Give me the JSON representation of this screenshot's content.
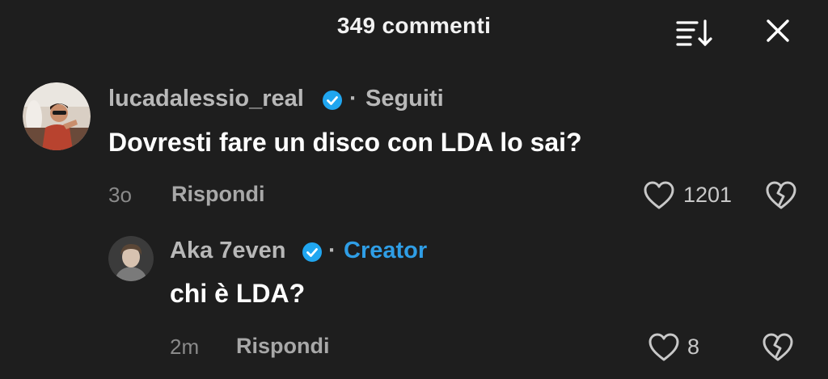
{
  "header": {
    "title": "349 commenti",
    "sort_icon": "sort-descending-icon",
    "close_icon": "close-icon"
  },
  "comments": [
    {
      "username": "lucadalessio_real",
      "verified": true,
      "separator": "·",
      "tag": "Seguiti",
      "text": "Dovresti fare un disco con LDA lo sai?",
      "time": "3o",
      "reply_label": "Rispondi",
      "likes": "1201"
    }
  ],
  "reply": {
    "username": "Aka 7even",
    "verified": true,
    "separator": "·",
    "tag": "Creator",
    "text": "chi è LDA?",
    "time": "2m",
    "reply_label": "Rispondi",
    "likes": "8"
  },
  "colors": {
    "background": "#1e1e1e",
    "verified_badge": "#20a6f0",
    "creator_tag": "#2f9ee6"
  }
}
